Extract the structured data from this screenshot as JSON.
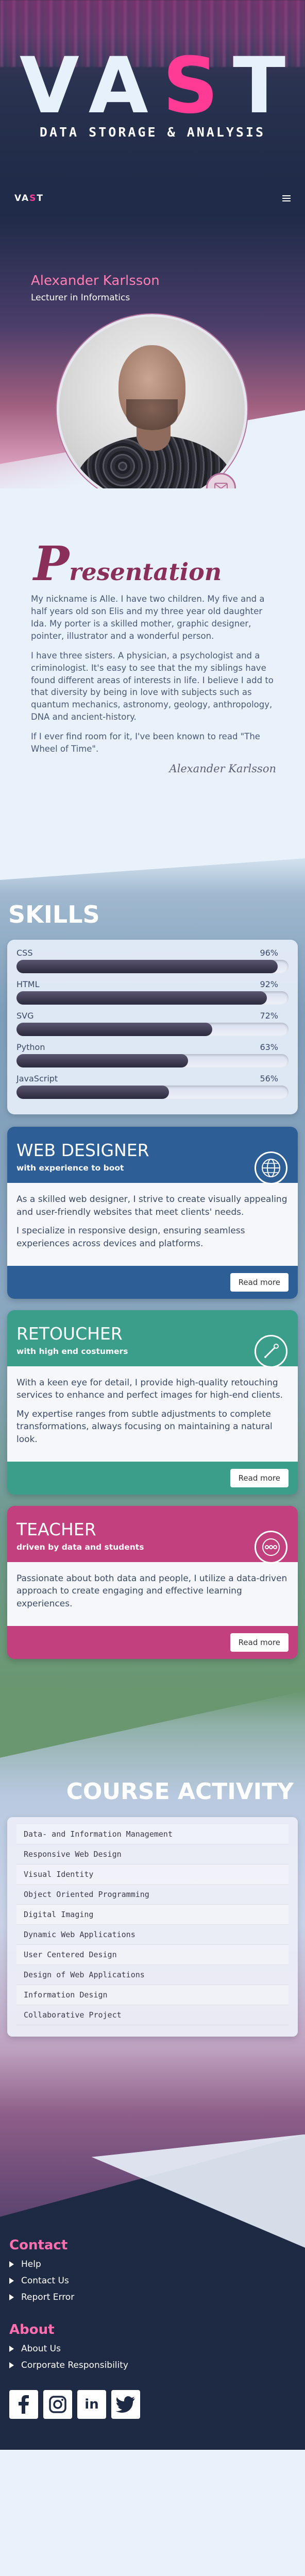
{
  "hero": {
    "title_start": "VA",
    "title_accent": "S",
    "title_end": "T",
    "tagline": "DATA STORAGE & ANALYSIS"
  },
  "nav": {
    "brand_start": "VA",
    "brand_accent": "S",
    "brand_end": "T",
    "menu_icon": "hamburger-icon"
  },
  "profile": {
    "name": "Alexander Karlsson",
    "role": "Lecturer in Informatics",
    "contact_icon": "mail-icon"
  },
  "presentation": {
    "title_initial": "P",
    "title_rest": "resentation",
    "paragraphs": [
      "My nickname is Alle. I have two children. My five and a half years old son Elis and my three year old daughter Ida. My porter is a skilled mother, graphic designer, pointer, illustrator and a wonderful person.",
      "I have three sisters. A physician, a psychologist and a criminologist. It's easy to see that the my siblings have found different areas of interests in life. I believe I add to that diversity by being in love with subjects such as quantum mechanics, astronomy, geology, anthropology, DNA and ancient-history.",
      "If I ever find room for it, I've been known to read \"The Wheel of Time\"."
    ],
    "signature": "Alexander Karlsson"
  },
  "skills": {
    "title": "SKILLS",
    "items": [
      {
        "name": "CSS",
        "percent_label": "96%",
        "level": 0.96
      },
      {
        "name": "HTML",
        "percent_label": "92%",
        "level": 0.92
      },
      {
        "name": "SVG",
        "percent_label": "72%",
        "level": 0.72
      },
      {
        "name": "Python",
        "percent_label": "63%",
        "level": 0.63
      },
      {
        "name": "JavaScript",
        "percent_label": "56%",
        "level": 0.56
      }
    ]
  },
  "services": [
    {
      "title": "WEB DESIGNER",
      "subtitle": "with experience to boot",
      "icon": "globe-icon",
      "paragraphs": [
        "As a skilled web designer, I strive to create visually appealing and user-friendly websites that meet clients' needs.",
        "I specialize in responsive design, ensuring seamless experiences across devices and platforms."
      ],
      "button": "Read more",
      "color": "#2d5f96"
    },
    {
      "title": "RETOUCHER",
      "subtitle": "with high end costumers",
      "icon": "brush-icon",
      "paragraphs": [
        "With a keen eye for detail, I provide high-quality retouching services to enhance and perfect images for high-end clients.",
        "My expertise ranges from subtle adjustments to complete transformations, always focusing on maintaining a natural look."
      ],
      "button": "Read more",
      "color": "#3b9e8a"
    },
    {
      "title": "TEACHER",
      "subtitle": "driven by data and students",
      "icon": "dots-icon",
      "paragraphs": [
        "Passionate about both data and people, I utilize a data-driven approach to create engaging and effective learning experiences."
      ],
      "button": "Read more",
      "color": "#c2407e"
    }
  ],
  "course": {
    "title": "COURSE ACTIVITY",
    "items": [
      "Data- and Information Management",
      "Responsive Web Design",
      "Visual Identity",
      "Object Oriented Programming",
      "Digital Imaging",
      "Dynamic Web Applications",
      "User Centered Design",
      "Design of Web Applications",
      "Information Design",
      "Collaborative Project"
    ]
  },
  "footer": {
    "contact_title": "Contact",
    "contact_links": [
      "Help",
      "Contact Us",
      "Report Error"
    ],
    "about_title": "About",
    "about_links": [
      "About Us",
      "Corporate Responsibility"
    ],
    "socials": [
      "facebook-icon",
      "instagram-icon",
      "linkedin-icon",
      "twitter-icon"
    ],
    "linkedin_text": "in"
  },
  "colors": {
    "accent_pink": "#ff3b95",
    "navy": "#1e2a44",
    "blue_card": "#2d5f96",
    "teal_card": "#3b9e8a",
    "magenta_card": "#c2407e"
  }
}
